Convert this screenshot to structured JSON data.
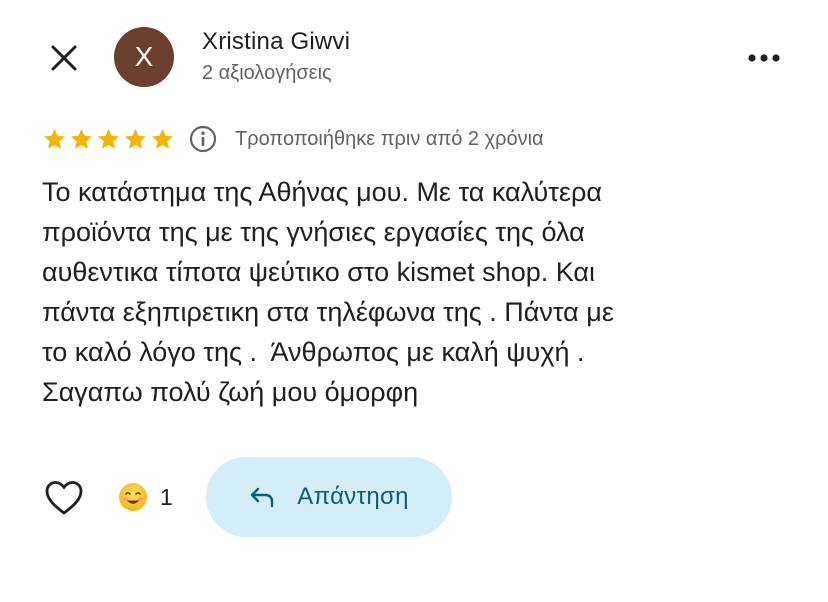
{
  "header": {
    "avatar_initial": "X",
    "avatar_color": "#6b3e2e",
    "reviewer_name": "Xristina Giwvi",
    "reviewer_meta": "2 αξιολογήσεις",
    "close_icon": "close-icon",
    "more_icon": "more-vert-icon"
  },
  "rating": {
    "stars": 5,
    "max_stars": 5,
    "star_color": "#f4b400",
    "info_icon": "info-icon",
    "modified_text": "Τροποποιήθηκε πριν από 2 χρόνια"
  },
  "review": {
    "text": "Το κατάστημα της Αθήνας μου. Με τα καλύτερα\nπροϊόντα της με της γνήσιες εργασίες της όλα\nαυθεντικα τίποτα ψεύτικο στο kismet shop. Και\nπάντα εξηπιρετικη στα τηλέφωνα της . Πάντα με\nτο καλό λόγο της .  Άνθρωπος με καλή ψυχή .\nΣαγαπω πολύ ζωή μου όμορφη"
  },
  "actions": {
    "like_icon": "heart-outline-icon",
    "reaction_icon": "smiling-face-emoji-icon",
    "reaction_count": "1",
    "reply_label": "Απάντηση",
    "reply_icon": "reply-arrow-icon",
    "reply_bg_color": "#d3eef8",
    "reply_text_color": "#0b5f7a"
  }
}
